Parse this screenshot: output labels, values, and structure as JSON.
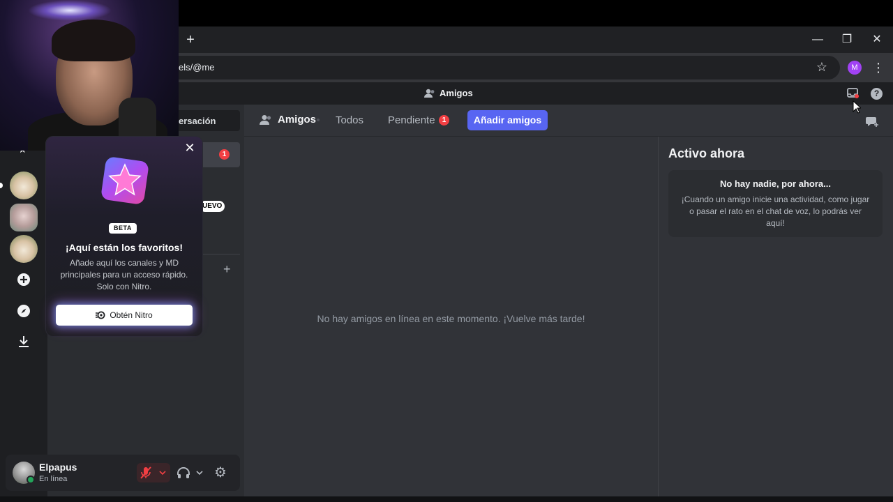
{
  "browser": {
    "new_tab": "+",
    "url": "els/@me",
    "profile_initial": "M",
    "win_min": "—",
    "win_restore": "❐",
    "win_close": "✕"
  },
  "title_strip": {
    "title": "Amigos"
  },
  "dm_column": {
    "conversation_label": "ersación",
    "dm_badge": "1",
    "nuevo_badge": "UEVO",
    "add_dm": "+"
  },
  "popup": {
    "beta": "BETA",
    "title": "¡Aquí están los favoritos!",
    "body": "Añade aquí los canales y MD principales para un acceso rápido. Solo con Nitro.",
    "button": "Obtén Nitro",
    "close": "✕"
  },
  "user": {
    "name": "Elpapus",
    "status": "En línea"
  },
  "header": {
    "friends": "Amigos",
    "tab_all": "Todos",
    "tab_pending": "Pendiente",
    "pending_count": "1",
    "add_friends": "Añadir amigos"
  },
  "main": {
    "empty_message": "No hay amigos en línea en este momento. ¡Vuelve más tarde!"
  },
  "active_now": {
    "title": "Activo ahora",
    "card_title": "No hay nadie, por ahora...",
    "card_body": "¡Cuando un amigo inicie una actividad, como jugar o pasar el rato en el chat de voz, lo podrás ver aquí!"
  },
  "colors": {
    "blurple": "#5865f2",
    "red": "#f23f43",
    "green": "#23a55a"
  }
}
